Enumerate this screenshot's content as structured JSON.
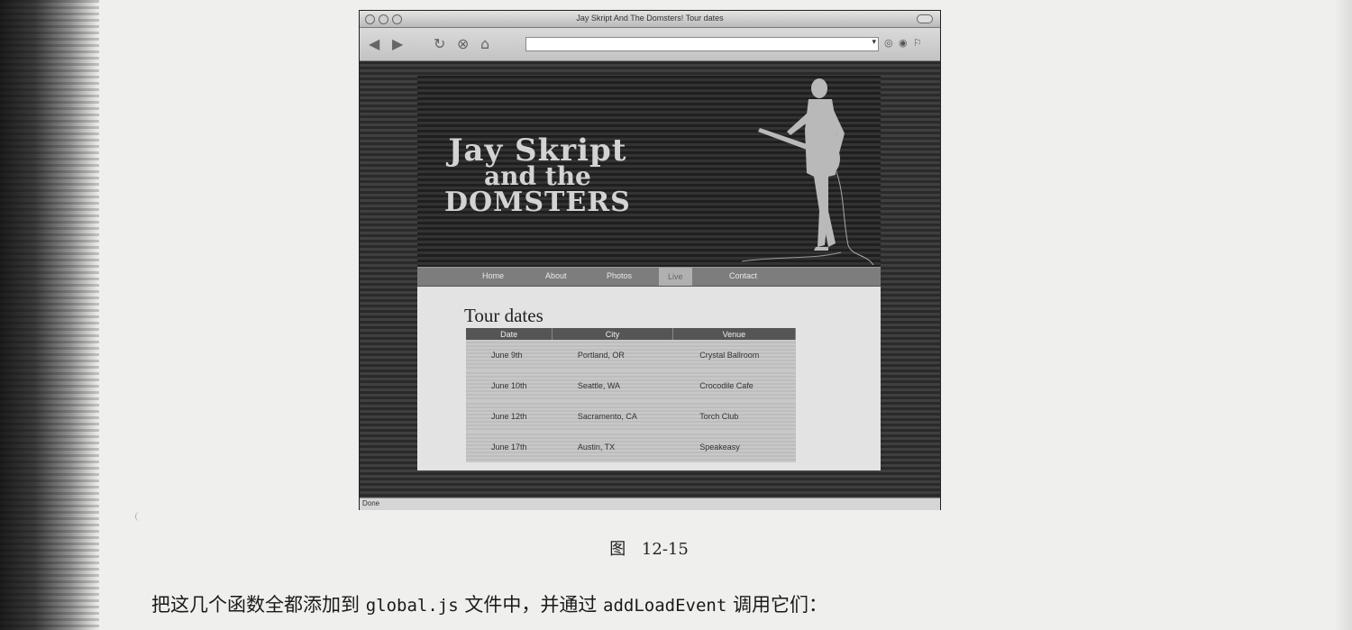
{
  "browser": {
    "window_title": "Jay Skript And The Domsters! Tour dates",
    "status": "Done"
  },
  "site": {
    "logo": {
      "line1": "Jay Skript",
      "line2": "and the",
      "line3": "DOMSTERS"
    },
    "nav": [
      "Home",
      "About",
      "Photos",
      "Live",
      "Contact"
    ],
    "page_title": "Tour dates",
    "table": {
      "headers": [
        "Date",
        "City",
        "Venue"
      ],
      "rows": [
        [
          "June 9th",
          "Portland, OR",
          "Crystal Ballroom"
        ],
        [
          "June 10th",
          "Seattle, WA",
          "Crocodile Cafe"
        ],
        [
          "June 12th",
          "Sacramento, CA",
          "Torch Club"
        ],
        [
          "June 17th",
          "Austin, TX",
          "Speakeasy"
        ]
      ]
    }
  },
  "caption": {
    "label": "图",
    "number": "12-15"
  },
  "paragraph": {
    "part1": "把这几个函数全都添加到 ",
    "code1": "global.js",
    "part2": " 文件中，并通过 ",
    "code2": "addLoadEvent",
    "part3": " 调用它们："
  },
  "colors": {
    "page_bg": "#efefed",
    "site_bg": "#333333",
    "content_bg": "#e3e3e3",
    "nav_bg": "#7d7d7d"
  }
}
